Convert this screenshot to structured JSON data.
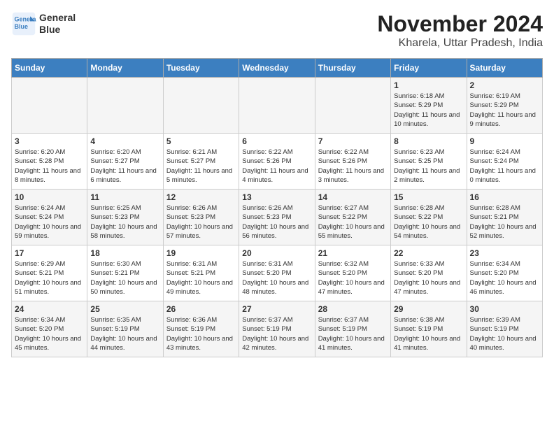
{
  "header": {
    "logo_line1": "General",
    "logo_line2": "Blue",
    "month_title": "November 2024",
    "location": "Kharela, Uttar Pradesh, India"
  },
  "weekdays": [
    "Sunday",
    "Monday",
    "Tuesday",
    "Wednesday",
    "Thursday",
    "Friday",
    "Saturday"
  ],
  "weeks": [
    [
      {
        "day": "",
        "info": ""
      },
      {
        "day": "",
        "info": ""
      },
      {
        "day": "",
        "info": ""
      },
      {
        "day": "",
        "info": ""
      },
      {
        "day": "",
        "info": ""
      },
      {
        "day": "1",
        "info": "Sunrise: 6:18 AM\nSunset: 5:29 PM\nDaylight: 11 hours and 10 minutes."
      },
      {
        "day": "2",
        "info": "Sunrise: 6:19 AM\nSunset: 5:29 PM\nDaylight: 11 hours and 9 minutes."
      }
    ],
    [
      {
        "day": "3",
        "info": "Sunrise: 6:20 AM\nSunset: 5:28 PM\nDaylight: 11 hours and 8 minutes."
      },
      {
        "day": "4",
        "info": "Sunrise: 6:20 AM\nSunset: 5:27 PM\nDaylight: 11 hours and 6 minutes."
      },
      {
        "day": "5",
        "info": "Sunrise: 6:21 AM\nSunset: 5:27 PM\nDaylight: 11 hours and 5 minutes."
      },
      {
        "day": "6",
        "info": "Sunrise: 6:22 AM\nSunset: 5:26 PM\nDaylight: 11 hours and 4 minutes."
      },
      {
        "day": "7",
        "info": "Sunrise: 6:22 AM\nSunset: 5:26 PM\nDaylight: 11 hours and 3 minutes."
      },
      {
        "day": "8",
        "info": "Sunrise: 6:23 AM\nSunset: 5:25 PM\nDaylight: 11 hours and 2 minutes."
      },
      {
        "day": "9",
        "info": "Sunrise: 6:24 AM\nSunset: 5:24 PM\nDaylight: 11 hours and 0 minutes."
      }
    ],
    [
      {
        "day": "10",
        "info": "Sunrise: 6:24 AM\nSunset: 5:24 PM\nDaylight: 10 hours and 59 minutes."
      },
      {
        "day": "11",
        "info": "Sunrise: 6:25 AM\nSunset: 5:23 PM\nDaylight: 10 hours and 58 minutes."
      },
      {
        "day": "12",
        "info": "Sunrise: 6:26 AM\nSunset: 5:23 PM\nDaylight: 10 hours and 57 minutes."
      },
      {
        "day": "13",
        "info": "Sunrise: 6:26 AM\nSunset: 5:23 PM\nDaylight: 10 hours and 56 minutes."
      },
      {
        "day": "14",
        "info": "Sunrise: 6:27 AM\nSunset: 5:22 PM\nDaylight: 10 hours and 55 minutes."
      },
      {
        "day": "15",
        "info": "Sunrise: 6:28 AM\nSunset: 5:22 PM\nDaylight: 10 hours and 54 minutes."
      },
      {
        "day": "16",
        "info": "Sunrise: 6:28 AM\nSunset: 5:21 PM\nDaylight: 10 hours and 52 minutes."
      }
    ],
    [
      {
        "day": "17",
        "info": "Sunrise: 6:29 AM\nSunset: 5:21 PM\nDaylight: 10 hours and 51 minutes."
      },
      {
        "day": "18",
        "info": "Sunrise: 6:30 AM\nSunset: 5:21 PM\nDaylight: 10 hours and 50 minutes."
      },
      {
        "day": "19",
        "info": "Sunrise: 6:31 AM\nSunset: 5:21 PM\nDaylight: 10 hours and 49 minutes."
      },
      {
        "day": "20",
        "info": "Sunrise: 6:31 AM\nSunset: 5:20 PM\nDaylight: 10 hours and 48 minutes."
      },
      {
        "day": "21",
        "info": "Sunrise: 6:32 AM\nSunset: 5:20 PM\nDaylight: 10 hours and 47 minutes."
      },
      {
        "day": "22",
        "info": "Sunrise: 6:33 AM\nSunset: 5:20 PM\nDaylight: 10 hours and 47 minutes."
      },
      {
        "day": "23",
        "info": "Sunrise: 6:34 AM\nSunset: 5:20 PM\nDaylight: 10 hours and 46 minutes."
      }
    ],
    [
      {
        "day": "24",
        "info": "Sunrise: 6:34 AM\nSunset: 5:20 PM\nDaylight: 10 hours and 45 minutes."
      },
      {
        "day": "25",
        "info": "Sunrise: 6:35 AM\nSunset: 5:19 PM\nDaylight: 10 hours and 44 minutes."
      },
      {
        "day": "26",
        "info": "Sunrise: 6:36 AM\nSunset: 5:19 PM\nDaylight: 10 hours and 43 minutes."
      },
      {
        "day": "27",
        "info": "Sunrise: 6:37 AM\nSunset: 5:19 PM\nDaylight: 10 hours and 42 minutes."
      },
      {
        "day": "28",
        "info": "Sunrise: 6:37 AM\nSunset: 5:19 PM\nDaylight: 10 hours and 41 minutes."
      },
      {
        "day": "29",
        "info": "Sunrise: 6:38 AM\nSunset: 5:19 PM\nDaylight: 10 hours and 41 minutes."
      },
      {
        "day": "30",
        "info": "Sunrise: 6:39 AM\nSunset: 5:19 PM\nDaylight: 10 hours and 40 minutes."
      }
    ]
  ]
}
